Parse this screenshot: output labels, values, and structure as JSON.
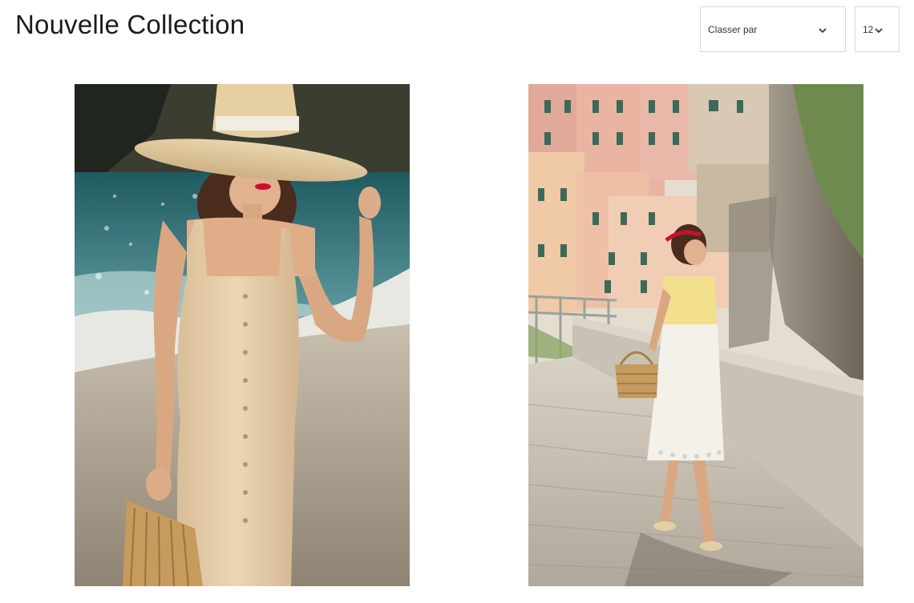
{
  "header": {
    "title": "Nouvelle Collection"
  },
  "controls": {
    "sort": {
      "label": "Classer par"
    },
    "per_page": {
      "value": "12"
    }
  },
  "products": [
    {
      "image": "woman in beige button-front dress and wide straw hat on beach"
    },
    {
      "image": "woman in yellow top and white lace skirt on cliffside walkway"
    }
  ],
  "colors": {
    "border": "#d9d9d9",
    "text": "#1c1c1c"
  }
}
